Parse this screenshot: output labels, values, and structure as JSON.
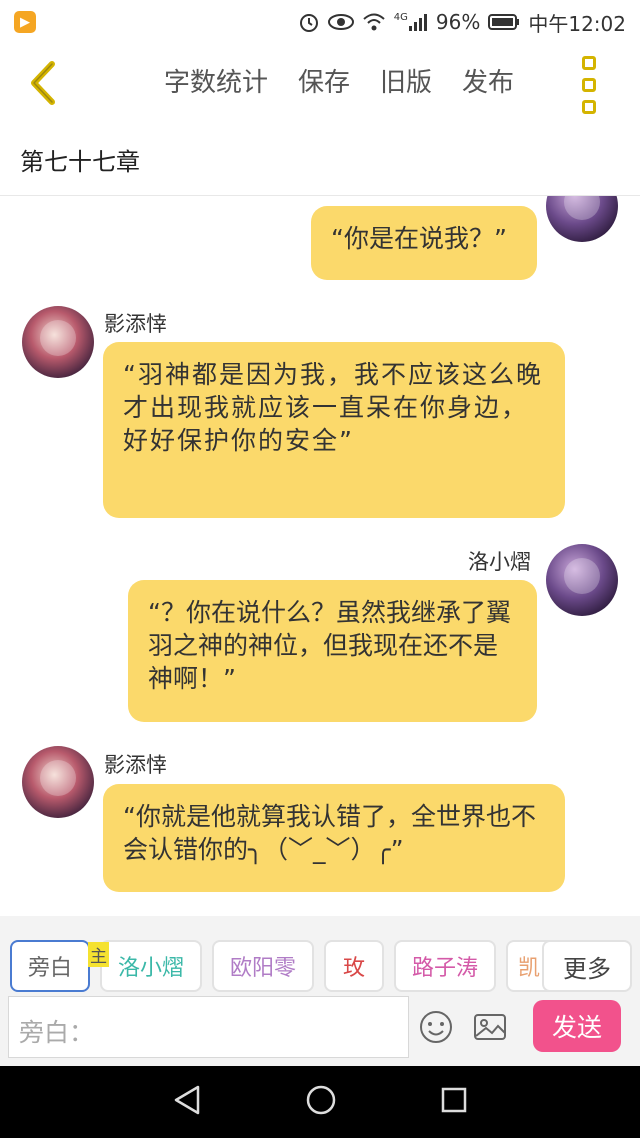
{
  "status_bar": {
    "network": "4G",
    "battery": "96%",
    "time": "中午12:02"
  },
  "toolbar": {
    "actions": [
      "字数统计",
      "保存",
      "旧版",
      "发布"
    ]
  },
  "chapter_title": "第七十七章",
  "messages": [
    {
      "side": "right",
      "speaker": "",
      "text": "“你是在说我？”"
    },
    {
      "side": "left",
      "speaker": "影添悻",
      "text": "“羽神都是因为我，我不应该这么晚才出现我就应该一直呆在你身边，好好保护你的安全”"
    },
    {
      "side": "right",
      "speaker": "洛小熠",
      "text": "“？你在说什么？虽然我继承了翼羽之神的神位，但我现在还不是神啊！”"
    },
    {
      "side": "left",
      "speaker": "影添悻",
      "text": "“你就是他就算我认错了，全世界也不会认错你的╮（﹀_﹀）╭”"
    }
  ],
  "characters": {
    "main_tag": "主",
    "chips": [
      {
        "label": "旁白",
        "color": "#666666"
      },
      {
        "label": "洛小熠",
        "color": "#3bb8a8"
      },
      {
        "label": "欧阳零",
        "color": "#b07cc6"
      },
      {
        "label": "玫",
        "color": "#d94848"
      },
      {
        "label": "路子涛",
        "color": "#d45aa8"
      },
      {
        "label": "凯",
        "color": "#e8a070"
      }
    ],
    "more_label": "更多"
  },
  "input": {
    "placeholder": "旁白："
  },
  "send_label": "发送",
  "icons": [
    "app-icon",
    "alarm-icon",
    "eye-icon",
    "wifi-icon",
    "signal-icon",
    "battery-icon",
    "back-chevron-icon",
    "more-menu-icon",
    "emoji-icon",
    "image-icon",
    "nav-back-icon",
    "nav-home-icon",
    "nav-recent-icon"
  ]
}
